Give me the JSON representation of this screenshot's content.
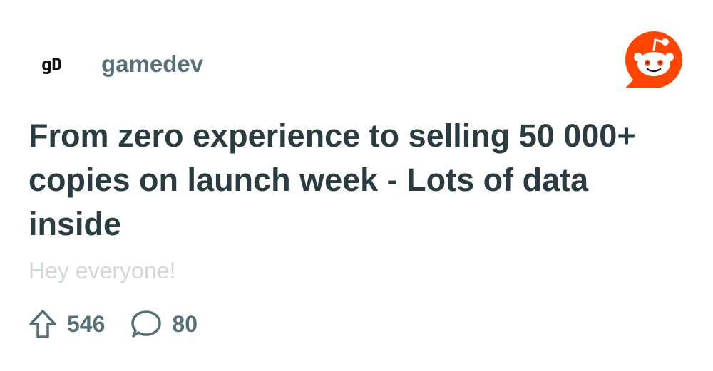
{
  "post": {
    "subreddit_logo_text": "gD",
    "subreddit": "gamedev",
    "title": "From zero experience to selling 50 000+ copies on launch week - Lots of data inside",
    "body_preview": "Hey everyone!",
    "upvotes": "546",
    "comments": "80"
  },
  "icons": {
    "brand": "reddit-snoo-icon",
    "upvote": "upvote-arrow-icon",
    "comment": "comment-bubble-icon"
  },
  "colors": {
    "brand": "#ff4500",
    "title": "#2a3c42",
    "meta": "#576f76",
    "preview": "#d3d7d9"
  }
}
